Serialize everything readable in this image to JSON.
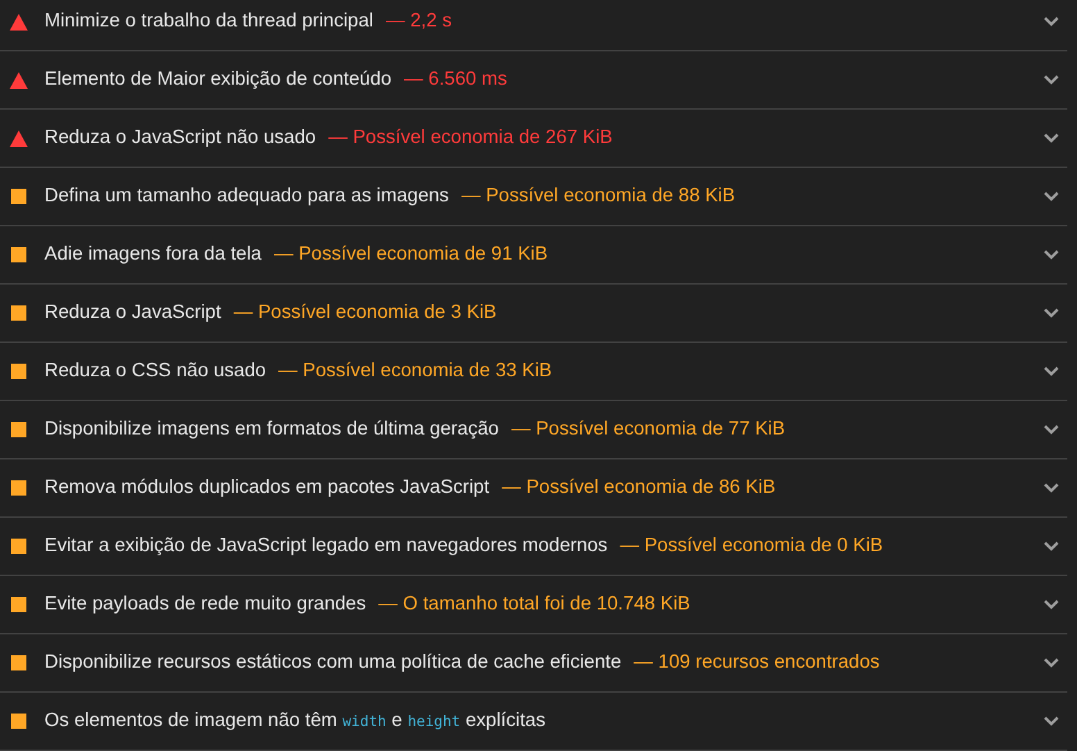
{
  "audits": [
    {
      "kind": "fail",
      "title": [
        {
          "kind": "text",
          "text": "Minimize o trabalho da thread principal"
        }
      ],
      "display_value": "— 2,2 s",
      "expanded": false
    },
    {
      "kind": "fail",
      "title": [
        {
          "kind": "text",
          "text": "Elemento de Maior exibição de conteúdo"
        }
      ],
      "display_value": "— 6.560 ms",
      "expanded": false
    },
    {
      "kind": "fail",
      "title": [
        {
          "kind": "text",
          "text": "Reduza o JavaScript não usado"
        }
      ],
      "display_value": "— Possível economia de 267 KiB",
      "expanded": false
    },
    {
      "kind": "average",
      "title": [
        {
          "kind": "text",
          "text": "Defina um tamanho adequado para as imagens"
        }
      ],
      "display_value": "— Possível economia de 88 KiB",
      "expanded": false
    },
    {
      "kind": "average",
      "title": [
        {
          "kind": "text",
          "text": "Adie imagens fora da tela"
        }
      ],
      "display_value": "— Possível economia de 91 KiB",
      "expanded": false
    },
    {
      "kind": "average",
      "title": [
        {
          "kind": "text",
          "text": "Reduza o JavaScript"
        }
      ],
      "display_value": "— Possível economia de 3 KiB",
      "expanded": false
    },
    {
      "kind": "average",
      "title": [
        {
          "kind": "text",
          "text": "Reduza o CSS não usado"
        }
      ],
      "display_value": "— Possível economia de 33 KiB",
      "expanded": false
    },
    {
      "kind": "average",
      "title": [
        {
          "kind": "text",
          "text": "Disponibilize imagens em formatos de última geração"
        }
      ],
      "display_value": "— Possível economia de 77 KiB",
      "expanded": false
    },
    {
      "kind": "average",
      "title": [
        {
          "kind": "text",
          "text": "Remova módulos duplicados em pacotes JavaScript"
        }
      ],
      "display_value": "— Possível economia de 86 KiB",
      "expanded": false
    },
    {
      "kind": "average",
      "title": [
        {
          "kind": "text",
          "text": "Evitar a exibição de JavaScript legado em navegadores modernos"
        }
      ],
      "display_value": "— Possível economia de 0 KiB",
      "expanded": false
    },
    {
      "kind": "average",
      "title": [
        {
          "kind": "text",
          "text": "Evite payloads de rede muito grandes"
        }
      ],
      "display_value": "— O tamanho total foi de 10.748 KiB",
      "expanded": false
    },
    {
      "kind": "average",
      "title": [
        {
          "kind": "text",
          "text": "Disponibilize recursos estáticos com uma política de cache eficiente"
        }
      ],
      "display_value": "— 109 recursos encontrados",
      "expanded": false
    },
    {
      "kind": "average",
      "title": [
        {
          "kind": "text",
          "text": "Os elementos de imagem não têm "
        },
        {
          "kind": "code",
          "text": "width"
        },
        {
          "kind": "text",
          "text": " e "
        },
        {
          "kind": "code",
          "text": "height"
        },
        {
          "kind": "text",
          "text": " explícitas"
        }
      ],
      "expanded": false
    }
  ]
}
